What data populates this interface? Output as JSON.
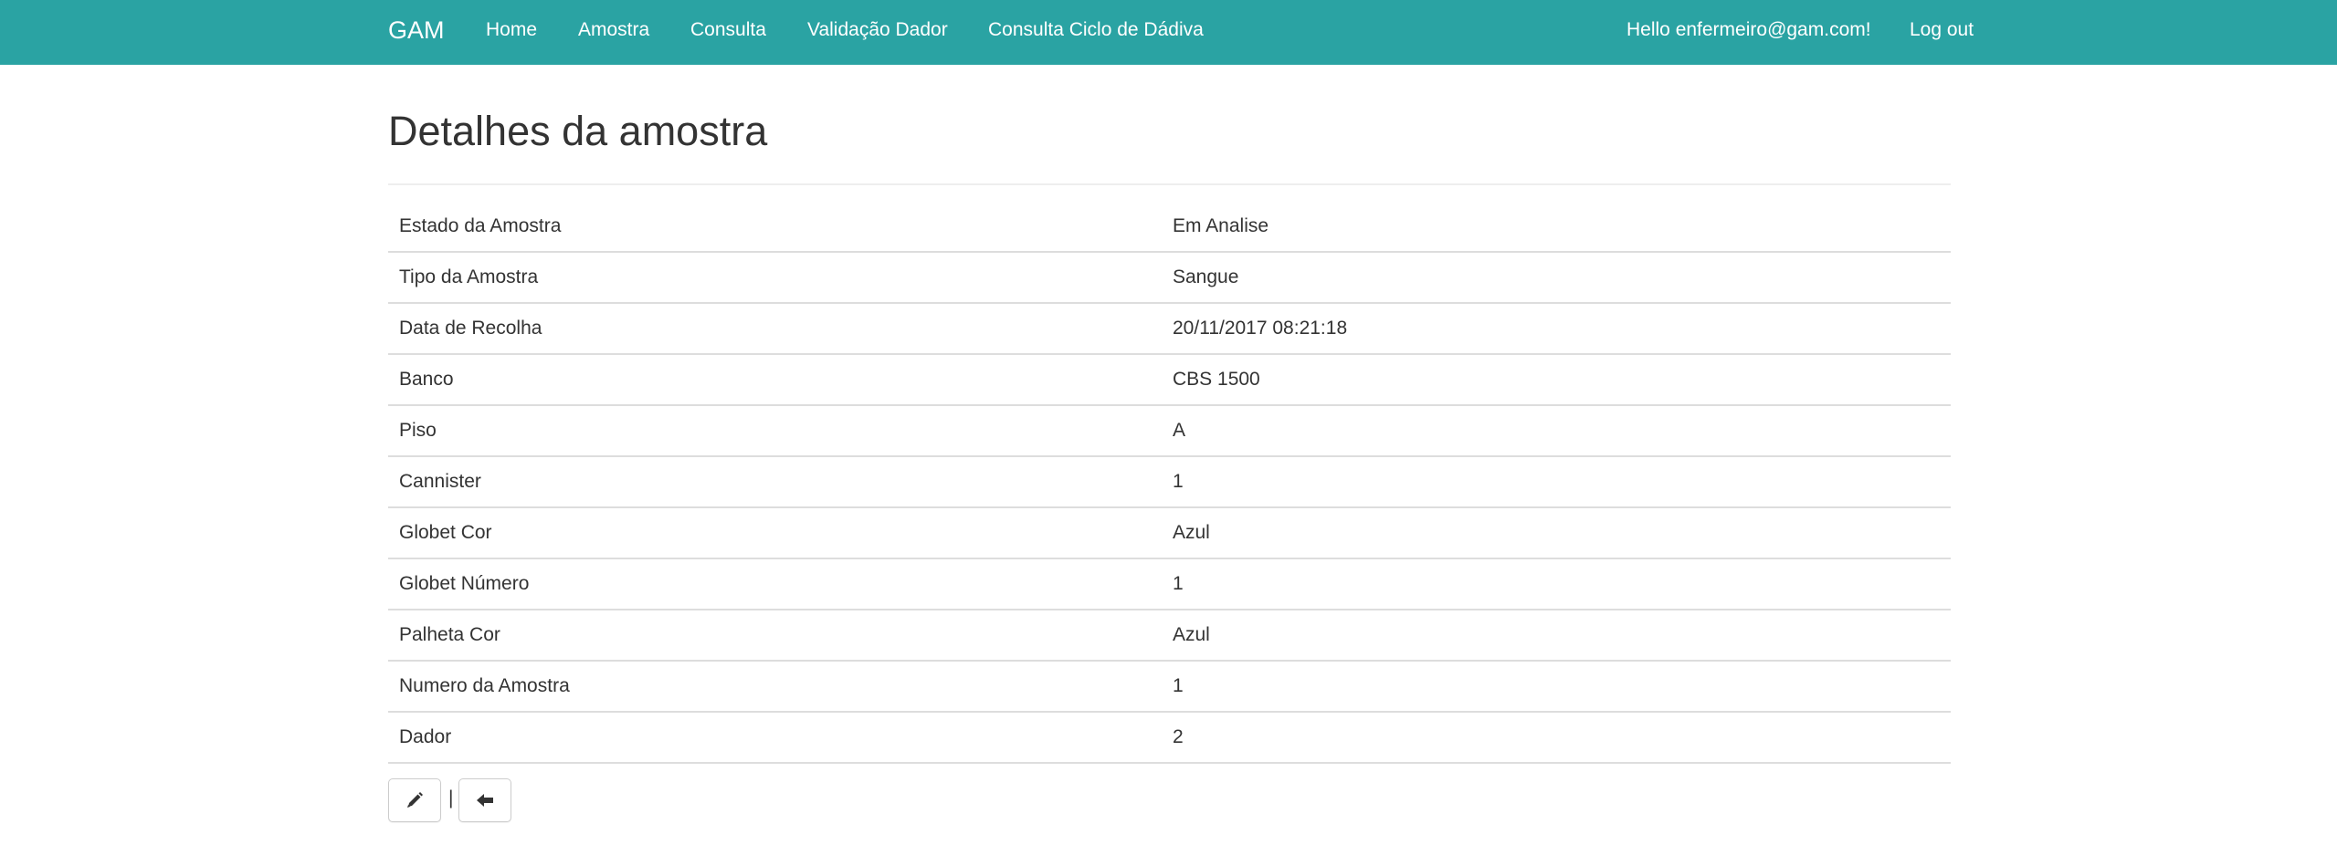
{
  "navbar": {
    "brand": "GAM",
    "links": [
      {
        "label": "Home"
      },
      {
        "label": "Amostra"
      },
      {
        "label": "Consulta"
      },
      {
        "label": "Validação Dador"
      },
      {
        "label": "Consulta Ciclo de Dádiva"
      }
    ],
    "greeting": "Hello enfermeiro@gam.com!",
    "logout": "Log out",
    "color": "#2aa3a3"
  },
  "page": {
    "title": "Detalhes da amostra"
  },
  "details": [
    {
      "label": "Estado da Amostra",
      "value": "Em Analise"
    },
    {
      "label": "Tipo da Amostra",
      "value": "Sangue"
    },
    {
      "label": "Data de Recolha",
      "value": "20/11/2017 08:21:18"
    },
    {
      "label": "Banco",
      "value": "CBS 1500"
    },
    {
      "label": "Piso",
      "value": "A"
    },
    {
      "label": "Cannister",
      "value": "1"
    },
    {
      "label": "Globet Cor",
      "value": "Azul"
    },
    {
      "label": "Globet Número",
      "value": "1"
    },
    {
      "label": "Palheta Cor",
      "value": "Azul"
    },
    {
      "label": "Numero da Amostra",
      "value": "1"
    },
    {
      "label": "Dador",
      "value": "2"
    }
  ],
  "actions": {
    "edit_icon": "pencil-icon",
    "back_icon": "arrow-left-icon",
    "separator": "|"
  }
}
